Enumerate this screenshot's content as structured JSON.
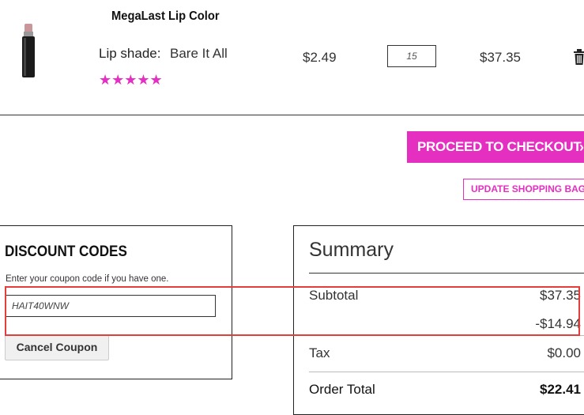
{
  "product": {
    "name": "MegaLast Lip Color",
    "shade_label": "Lip shade:",
    "shade_value": "Bare It All",
    "stars": "★★★★★",
    "price": "$2.49",
    "quantity": "15",
    "line_total": "$37.35",
    "rating": 4.5
  },
  "actions": {
    "checkout_label": "PROCEED TO CHECKOUT",
    "checkout_chevron": "›",
    "update_label": "UPDATE SHOPPING BAG"
  },
  "discount": {
    "title": "DISCOUNT CODES",
    "help": "Enter your coupon code if you have one.",
    "code": "HAIT40WNW",
    "cancel_label": "Cancel Coupon"
  },
  "summary": {
    "title": "Summary",
    "subtotal_label": "Subtotal",
    "subtotal_value": "$37.35",
    "discount_value": "-$14.94",
    "tax_label": "Tax",
    "tax_value": "$0.00",
    "order_total_label": "Order Total",
    "order_total_value": "$22.41"
  },
  "colors": {
    "accent": "#e52fc1",
    "highlight": "#e53c3c"
  }
}
